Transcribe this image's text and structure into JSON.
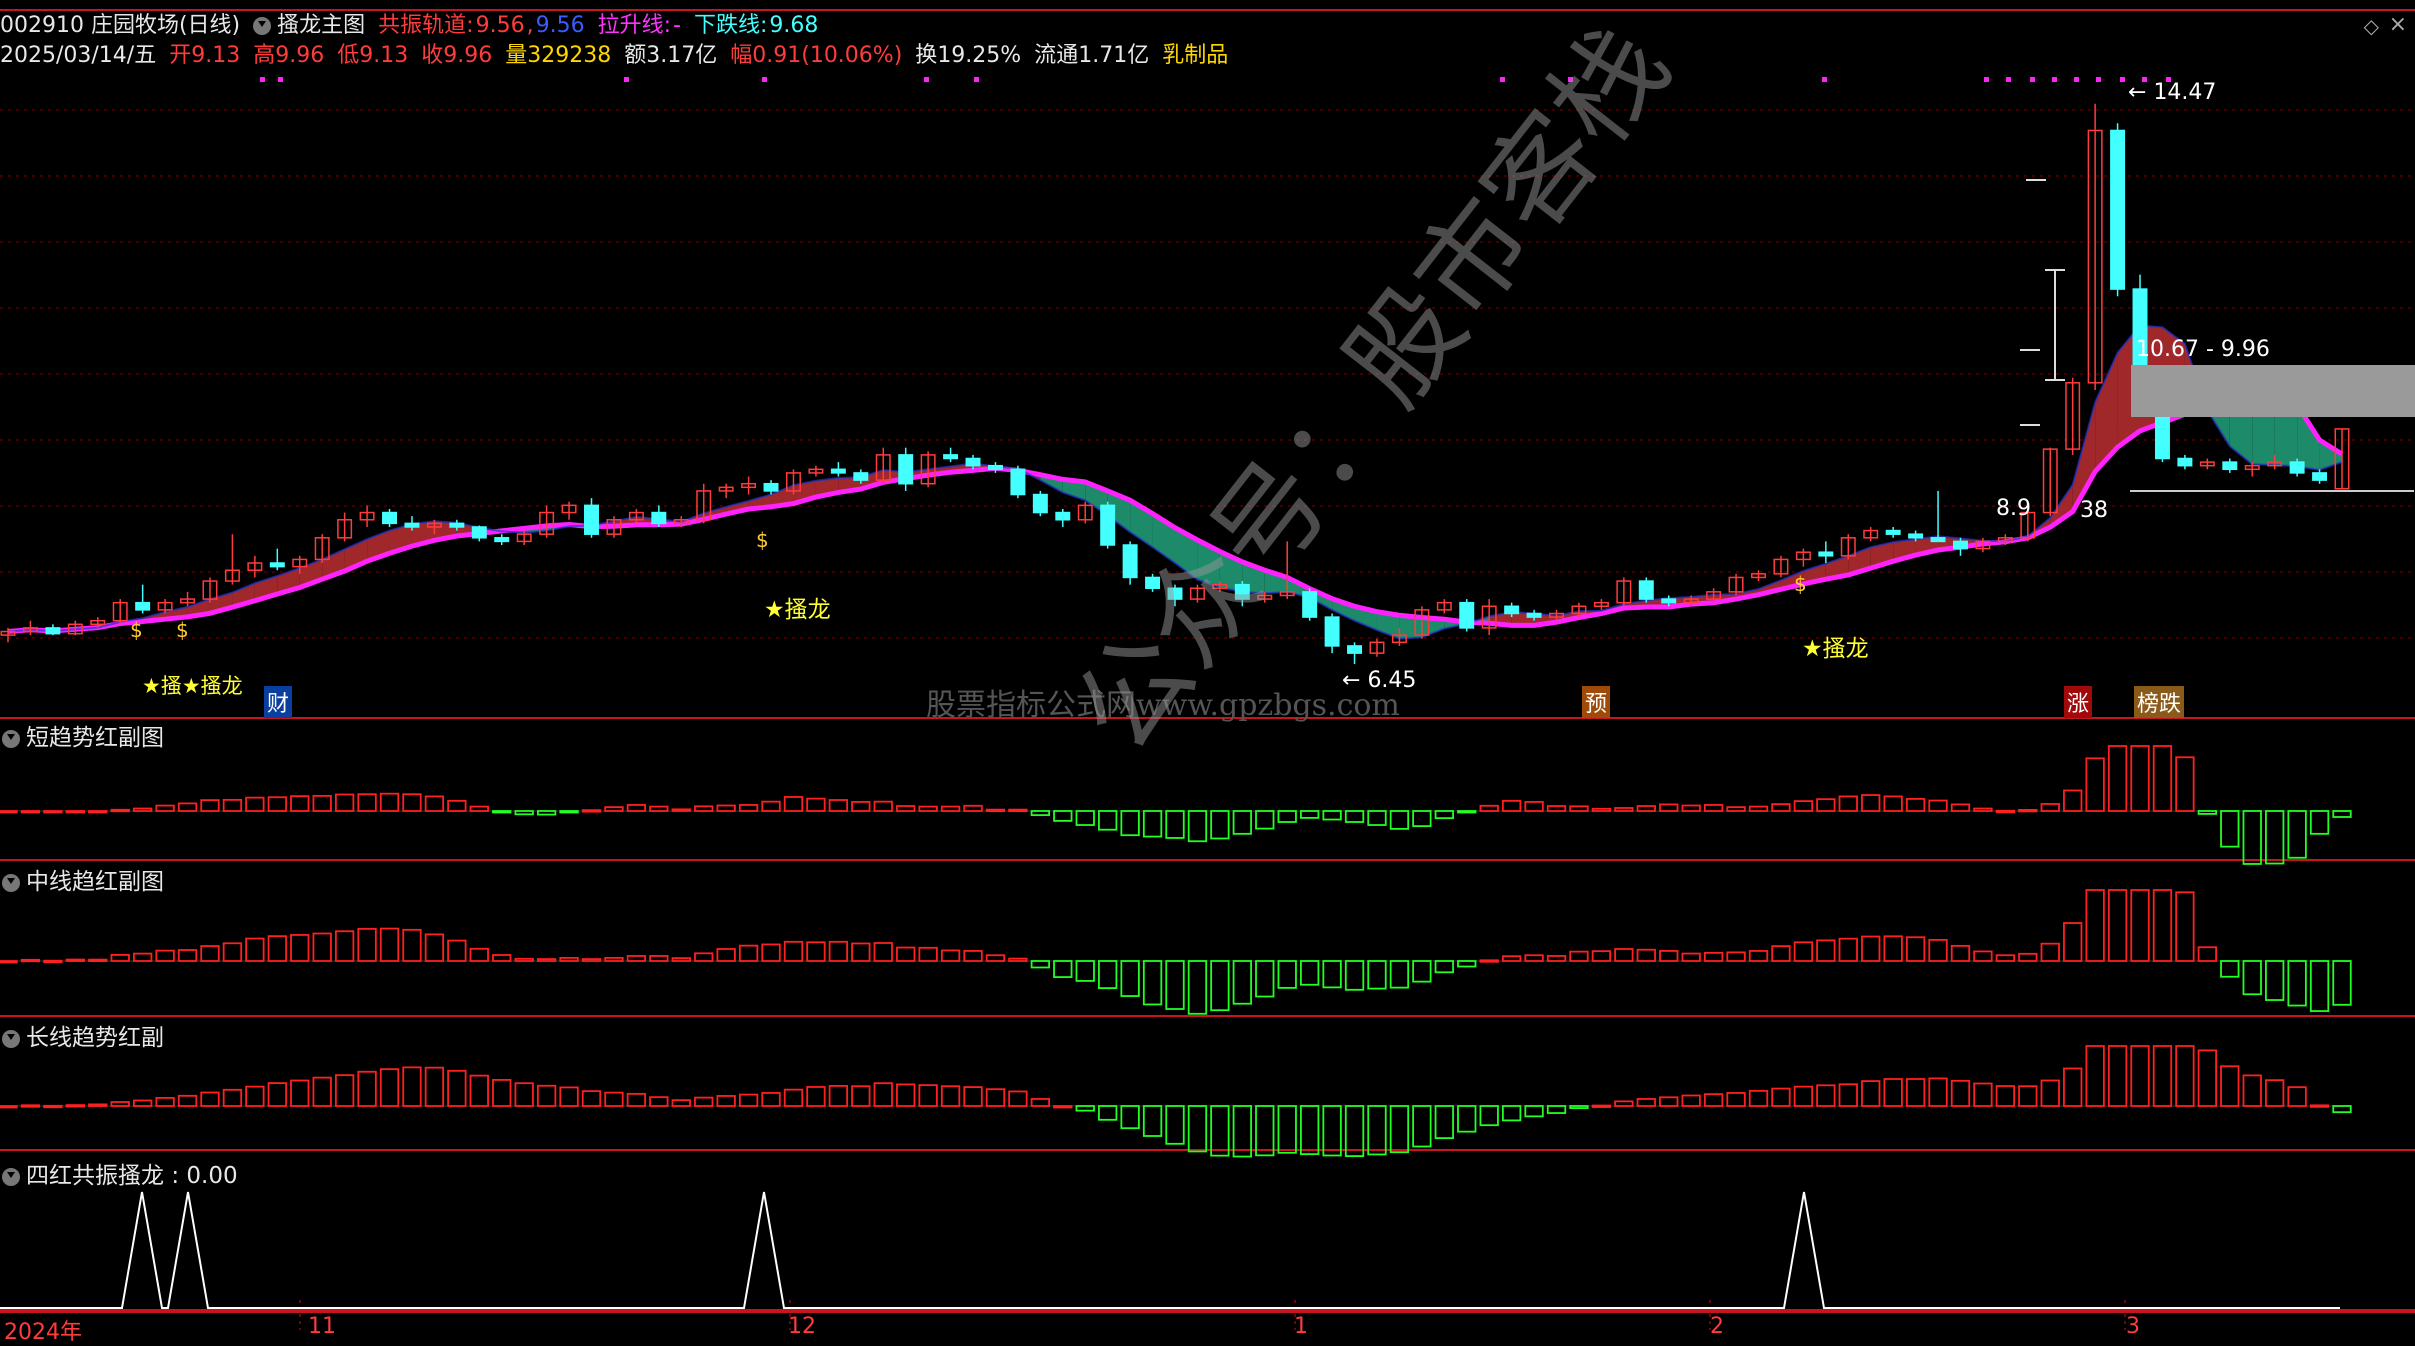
{
  "header": {
    "code_name": "002910 庄园牧场(日线)",
    "indicator": "搔龙主图",
    "channel_label": "共振轨道:",
    "channel_v1": "9.56",
    "channel_sep": ",",
    "channel_v2": "9.56",
    "rise_label": "拉升线:",
    "rise_val": "-",
    "fall_label": "下跌线:",
    "fall_val": "9.68"
  },
  "quote": {
    "date": "2025/03/14/五",
    "open_label": "开",
    "open": "9.13",
    "high_label": "高",
    "high": "9.96",
    "low_label": "低",
    "low": "9.13",
    "close_label": "收",
    "close": "9.96",
    "vol_label": "量",
    "vol": "329238",
    "amt_label": "额",
    "amt": "3.17亿",
    "chg_label": "幅",
    "chg": "0.91(10.06%)",
    "turn_label": "换",
    "turn": "19.25%",
    "float_label": "流通",
    "float": "1.71亿",
    "sector": "乳制品"
  },
  "main_chart": {
    "price_high_label": "14.47",
    "price_low_label": "6.45",
    "box_label": "10.67 - 9.96",
    "partial_left": "8.9",
    "partial_right": "38",
    "signal_label": "★搔龙",
    "signal_label_double": "★搔★搔龙",
    "events": [
      "财",
      "预",
      "涨",
      "榜跌"
    ]
  },
  "watermarks": {
    "site": "股票指标公式网www.gpzbgs.com",
    "diag": "公众号：股市客栈"
  },
  "panels": [
    {
      "title": "短趋势红副图"
    },
    {
      "title": "中线趋红副图"
    },
    {
      "title": "长线趋势红副"
    },
    {
      "title": "四红共振搔龙",
      "value": ": 0.00"
    }
  ],
  "axis": {
    "labels": [
      "2024年",
      "11",
      "12",
      "1",
      "2",
      "3"
    ]
  },
  "colors": {
    "up": "#ff3c3c",
    "down": "#44ffff",
    "ma": "#ff22ff",
    "band_up": "#a0282a",
    "band_down": "#1d8a6a",
    "bar_pos": "#ff2020",
    "bar_neg": "#22ff22",
    "grid": "#7a0000"
  },
  "chart_data": {
    "type": "candlestick",
    "ylim": [
      6.2,
      14.8
    ],
    "candles": [
      [
        7.1,
        7.2,
        7.0,
        7.15
      ],
      [
        7.15,
        7.3,
        7.1,
        7.2
      ],
      [
        7.2,
        7.25,
        7.1,
        7.12
      ],
      [
        7.12,
        7.3,
        7.1,
        7.25
      ],
      [
        7.25,
        7.35,
        7.2,
        7.3
      ],
      [
        7.3,
        7.6,
        7.25,
        7.55
      ],
      [
        7.55,
        7.8,
        7.4,
        7.45
      ],
      [
        7.45,
        7.6,
        7.4,
        7.55
      ],
      [
        7.55,
        7.7,
        7.5,
        7.6
      ],
      [
        7.6,
        7.9,
        7.55,
        7.85
      ],
      [
        7.85,
        8.5,
        7.8,
        8.0
      ],
      [
        8.0,
        8.2,
        7.9,
        8.1
      ],
      [
        8.1,
        8.3,
        8.0,
        8.05
      ],
      [
        8.05,
        8.2,
        7.95,
        8.15
      ],
      [
        8.15,
        8.5,
        8.1,
        8.45
      ],
      [
        8.45,
        8.8,
        8.4,
        8.7
      ],
      [
        8.7,
        8.9,
        8.6,
        8.8
      ],
      [
        8.8,
        8.85,
        8.6,
        8.65
      ],
      [
        8.65,
        8.75,
        8.55,
        8.6
      ],
      [
        8.6,
        8.7,
        8.5,
        8.65
      ],
      [
        8.65,
        8.7,
        8.55,
        8.6
      ],
      [
        8.6,
        8.62,
        8.4,
        8.45
      ],
      [
        8.45,
        8.5,
        8.35,
        8.4
      ],
      [
        8.4,
        8.55,
        8.35,
        8.5
      ],
      [
        8.5,
        8.9,
        8.45,
        8.8
      ],
      [
        8.8,
        8.95,
        8.7,
        8.9
      ],
      [
        8.9,
        9.0,
        8.45,
        8.5
      ],
      [
        8.5,
        8.75,
        8.45,
        8.7
      ],
      [
        8.7,
        8.85,
        8.65,
        8.8
      ],
      [
        8.8,
        8.9,
        8.6,
        8.65
      ],
      [
        8.65,
        8.75,
        8.6,
        8.7
      ],
      [
        8.7,
        9.2,
        8.65,
        9.1
      ],
      [
        9.1,
        9.2,
        9.0,
        9.15
      ],
      [
        9.15,
        9.3,
        9.05,
        9.2
      ],
      [
        9.2,
        9.25,
        9.05,
        9.1
      ],
      [
        9.1,
        9.4,
        9.05,
        9.35
      ],
      [
        9.35,
        9.45,
        9.3,
        9.4
      ],
      [
        9.4,
        9.5,
        9.3,
        9.35
      ],
      [
        9.35,
        9.4,
        9.2,
        9.25
      ],
      [
        9.25,
        9.7,
        9.2,
        9.6
      ],
      [
        9.6,
        9.7,
        9.1,
        9.2
      ],
      [
        9.2,
        9.65,
        9.15,
        9.6
      ],
      [
        9.6,
        9.7,
        9.5,
        9.55
      ],
      [
        9.55,
        9.6,
        9.4,
        9.45
      ],
      [
        9.45,
        9.5,
        9.35,
        9.4
      ],
      [
        9.4,
        9.45,
        9.0,
        9.05
      ],
      [
        9.05,
        9.1,
        8.75,
        8.8
      ],
      [
        8.8,
        8.85,
        8.6,
        8.7
      ],
      [
        8.7,
        8.95,
        8.65,
        8.9
      ],
      [
        8.9,
        8.95,
        8.3,
        8.35
      ],
      [
        8.35,
        8.4,
        7.8,
        7.9
      ],
      [
        7.9,
        7.95,
        7.7,
        7.75
      ],
      [
        7.75,
        7.8,
        7.5,
        7.6
      ],
      [
        7.6,
        7.8,
        7.55,
        7.75
      ],
      [
        7.75,
        7.85,
        7.7,
        7.8
      ],
      [
        7.8,
        7.85,
        7.5,
        7.6
      ],
      [
        7.6,
        7.7,
        7.55,
        7.65
      ],
      [
        7.65,
        8.4,
        7.6,
        7.7
      ],
      [
        7.7,
        7.75,
        7.3,
        7.35
      ],
      [
        7.35,
        7.4,
        6.85,
        6.95
      ],
      [
        6.95,
        7.0,
        6.7,
        6.85
      ],
      [
        6.85,
        7.05,
        6.8,
        7.0
      ],
      [
        7.0,
        7.2,
        6.95,
        7.1
      ],
      [
        7.1,
        7.5,
        7.05,
        7.45
      ],
      [
        7.45,
        7.6,
        7.4,
        7.55
      ],
      [
        7.55,
        7.6,
        7.15,
        7.2
      ],
      [
        7.2,
        7.6,
        7.1,
        7.5
      ],
      [
        7.5,
        7.55,
        7.35,
        7.4
      ],
      [
        7.4,
        7.45,
        7.3,
        7.35
      ],
      [
        7.35,
        7.45,
        7.3,
        7.4
      ],
      [
        7.4,
        7.55,
        7.35,
        7.5
      ],
      [
        7.5,
        7.6,
        7.45,
        7.55
      ],
      [
        7.55,
        7.9,
        7.5,
        7.85
      ],
      [
        7.85,
        7.9,
        7.55,
        7.6
      ],
      [
        7.6,
        7.65,
        7.5,
        7.55
      ],
      [
        7.55,
        7.65,
        7.5,
        7.6
      ],
      [
        7.6,
        7.75,
        7.55,
        7.7
      ],
      [
        7.7,
        7.95,
        7.65,
        7.9
      ],
      [
        7.9,
        8.0,
        7.85,
        7.95
      ],
      [
        7.95,
        8.2,
        7.9,
        8.15
      ],
      [
        8.15,
        8.3,
        8.05,
        8.25
      ],
      [
        8.25,
        8.4,
        8.1,
        8.2
      ],
      [
        8.2,
        8.5,
        8.15,
        8.45
      ],
      [
        8.45,
        8.6,
        8.4,
        8.55
      ],
      [
        8.55,
        8.6,
        8.45,
        8.5
      ],
      [
        8.5,
        8.55,
        8.4,
        8.45
      ],
      [
        8.45,
        9.1,
        8.4,
        8.4
      ],
      [
        8.4,
        8.45,
        8.2,
        8.3
      ],
      [
        8.3,
        8.45,
        8.25,
        8.4
      ],
      [
        8.4,
        8.5,
        8.35,
        8.45
      ],
      [
        8.45,
        8.85,
        8.4,
        8.8
      ],
      [
        8.8,
        9.7,
        8.75,
        9.68
      ],
      [
        9.68,
        10.67,
        9.6,
        10.6
      ],
      [
        10.6,
        14.47,
        10.5,
        14.1
      ],
      [
        14.1,
        14.2,
        11.8,
        11.9
      ],
      [
        11.9,
        12.1,
        10.6,
        10.7
      ],
      [
        10.7,
        10.8,
        9.5,
        9.55
      ],
      [
        9.55,
        9.6,
        9.4,
        9.45
      ],
      [
        9.45,
        9.55,
        9.4,
        9.5
      ],
      [
        9.5,
        9.55,
        9.35,
        9.4
      ],
      [
        9.4,
        9.5,
        9.3,
        9.45
      ],
      [
        9.45,
        9.6,
        9.4,
        9.5
      ],
      [
        9.5,
        9.55,
        9.3,
        9.35
      ],
      [
        9.35,
        9.4,
        9.2,
        9.25
      ],
      [
        9.13,
        9.96,
        9.13,
        9.96
      ]
    ]
  }
}
